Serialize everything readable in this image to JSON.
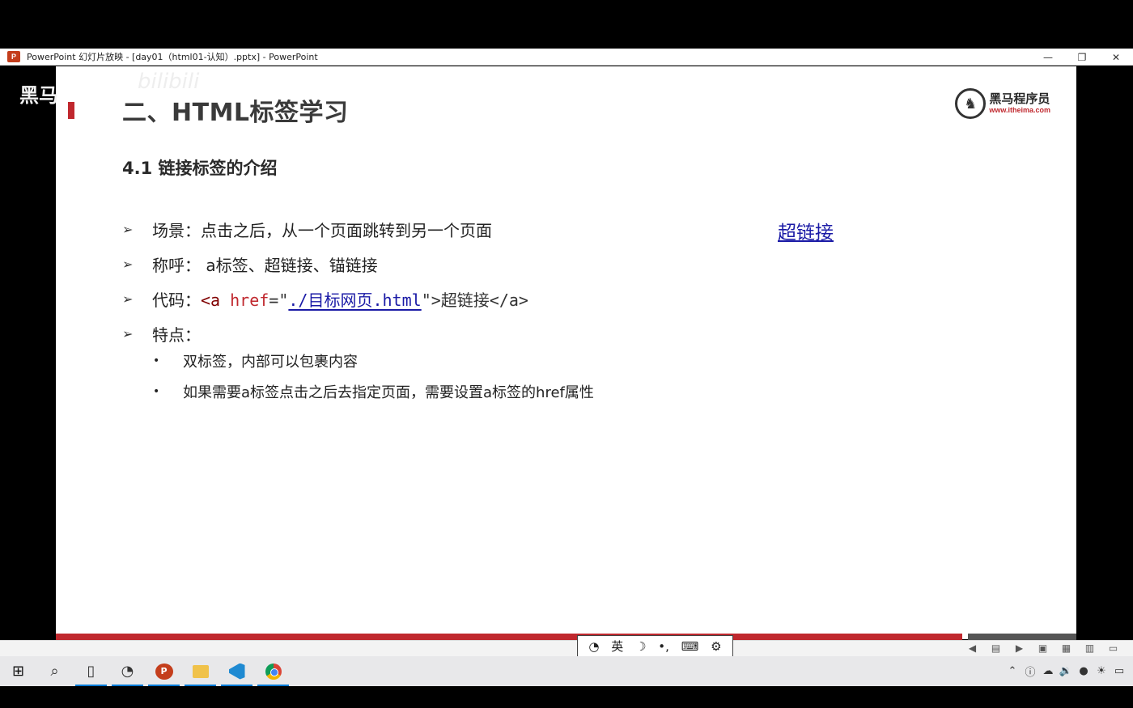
{
  "window": {
    "title": "PowerPoint 幻灯片放映 - [day01（html01-认知）.pptx] - PowerPoint",
    "app_icon": "P",
    "minimize": "—",
    "restore": "❐",
    "close": "✕"
  },
  "watermark": {
    "text": "黑马",
    "bili": "bilibili"
  },
  "slide": {
    "title": "二、HTML标签学习",
    "logo": {
      "name": "黑马程序员",
      "url": "www.itheima.com"
    },
    "subtitle": "4.1 链接标签的介绍",
    "bullets": [
      {
        "label": "场景：",
        "text": "点击之后，从一个页面跳转到另一个页面"
      },
      {
        "label": "称呼：",
        "text": " a标签、超链接、锚链接"
      },
      {
        "label": "代码：",
        "code": {
          "open": "<a ",
          "attr": "href",
          "eq": "=\"",
          "value": "./目标网页.html",
          "close": "\">",
          "inner": "超链接",
          "end": "</a>"
        }
      },
      {
        "label": "特点：",
        "text": ""
      }
    ],
    "sub_bullets": [
      "双标签，内部可以包裹内容",
      "如果需要a标签点击之后去指定页面，需要设置a标签的href属性"
    ],
    "hyperlink": "超链接"
  },
  "ime": {
    "mode": "英",
    "moon": "☽",
    "punct": "•,",
    "keyboard": "⌨",
    "settings": "⚙"
  },
  "colors": {
    "accent_red": "#c0282e",
    "link_blue": "#1a1aa6",
    "ppt_orange": "#c43e1c"
  }
}
